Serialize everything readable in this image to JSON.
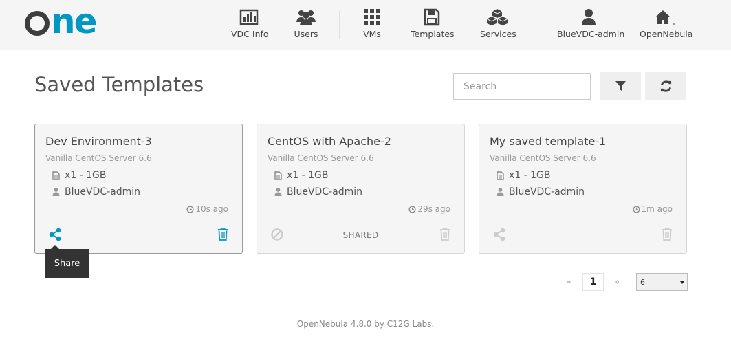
{
  "brand": {
    "logo_text": "one",
    "logo_colors": {
      "o": "#3d3d3d",
      "ne": "#0098c3"
    }
  },
  "nav": {
    "vdc_info": "VDC Info",
    "users": "Users",
    "vms": "VMs",
    "templates": "Templates",
    "services": "Services",
    "user": "BlueVDC-admin",
    "zone": "OpenNebula"
  },
  "page": {
    "title": "Saved Templates"
  },
  "search": {
    "placeholder": "Search",
    "value": ""
  },
  "cards": [
    {
      "title": "Dev Environment-3",
      "subtitle": "Vanilla CentOS Server 6.6",
      "capacity": "x1 - 1GB",
      "owner": "BlueVDC-admin",
      "time": "10s ago",
      "status": "",
      "share_icon": "share-icon",
      "delete_icon": "trash-icon"
    },
    {
      "title": "CentOS with Apache-2",
      "subtitle": "Vanilla CentOS Server 6.6",
      "capacity": "x1 - 1GB",
      "owner": "BlueVDC-admin",
      "time": "29s ago",
      "status": "SHARED",
      "share_icon": "ban-icon",
      "delete_icon": "trash-icon"
    },
    {
      "title": "My saved template-1",
      "subtitle": "Vanilla CentOS Server 6.6",
      "capacity": "x1 - 1GB",
      "owner": "BlueVDC-admin",
      "time": "1m ago",
      "status": "",
      "share_icon": "share-icon",
      "delete_icon": "trash-icon"
    }
  ],
  "tooltip": {
    "text": "Share"
  },
  "pagination": {
    "prev": "«",
    "current": "1",
    "next": "»",
    "page_size": "6"
  },
  "footer": {
    "text": "OpenNebula 4.8.0 by C12G Labs."
  },
  "colors": {
    "accent": "#0098c3",
    "text": "#555555",
    "card_bg": "#f5f5f5",
    "tooltip_bg": "#333333"
  }
}
